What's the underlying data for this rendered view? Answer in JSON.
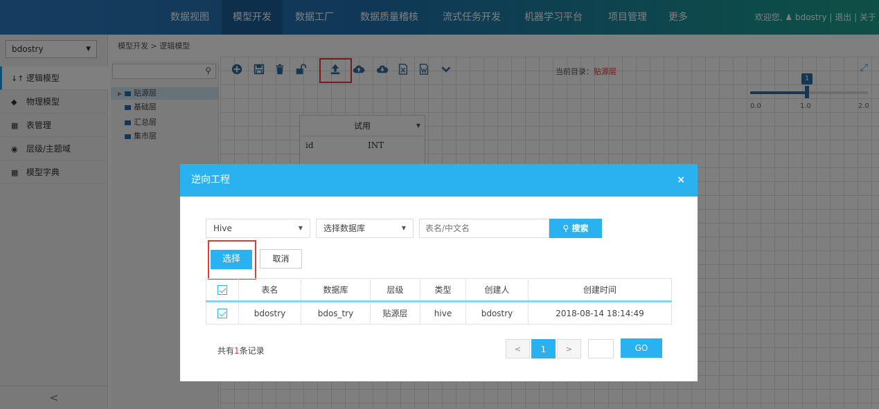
{
  "topnav": {
    "items": [
      {
        "label": "数据视图"
      },
      {
        "label": "模型开发"
      },
      {
        "label": "数据工厂"
      },
      {
        "label": "数据质量稽核"
      },
      {
        "label": "流式任务开发"
      },
      {
        "label": "机器学习平台"
      },
      {
        "label": "项目管理"
      },
      {
        "label": "更多"
      }
    ],
    "active_index": 1,
    "welcome": "欢迎您,",
    "username": "bdostry",
    "logout": "退出",
    "about": "关于",
    "separator": "|"
  },
  "sidebar": {
    "project": "bdostry",
    "items": [
      {
        "label": "逻辑模型",
        "icon": "sort-icon",
        "glyph": "↓↑"
      },
      {
        "label": "物理模型",
        "icon": "cube-icon",
        "glyph": "◆"
      },
      {
        "label": "表管理",
        "icon": "grid-icon",
        "glyph": "▦"
      },
      {
        "label": "层级/主题域",
        "icon": "layers-icon",
        "glyph": "◉"
      },
      {
        "label": "模型字典",
        "icon": "grid-icon",
        "glyph": "▦"
      }
    ],
    "collapse_glyph": "<"
  },
  "breadcrumb": "模型开发 > 逻辑模型",
  "tree": {
    "search_placeholder": "",
    "nodes": [
      {
        "label": "贴源层",
        "selected": true
      },
      {
        "label": "基础层",
        "selected": false
      },
      {
        "label": "汇总层",
        "selected": false
      },
      {
        "label": "集市层",
        "selected": false
      }
    ]
  },
  "toolbar": {
    "current_dir_label": "当前目录：",
    "current_dir_value": "贴源层"
  },
  "zoom": {
    "value": "1",
    "ticks": [
      "0.0",
      "1.0",
      "2.0"
    ]
  },
  "entity": {
    "title": "试用",
    "rows": [
      {
        "name": "id",
        "type": "INT"
      }
    ]
  },
  "modal": {
    "title": "逆向工程",
    "close": "×",
    "db_type": "Hive",
    "db_select_placeholder": "选择数据库",
    "search_placeholder": "表名/中文名",
    "search_button": "搜索",
    "select_button": "选择",
    "cancel_button": "取消",
    "columns": [
      "表名",
      "数据库",
      "层级",
      "类型",
      "创建人",
      "创建时间"
    ],
    "rows": [
      {
        "name": "bdostry",
        "database": "bdos_try",
        "layer": "贴源层",
        "type": "hive",
        "creator": "bdostry",
        "created": "2018-08-14 18:14:49"
      }
    ],
    "total_prefix": "共有",
    "total_count": "1",
    "total_suffix": "条记录",
    "pager": {
      "prev": "<",
      "current": "1",
      "next": ">",
      "go": "GO"
    }
  }
}
